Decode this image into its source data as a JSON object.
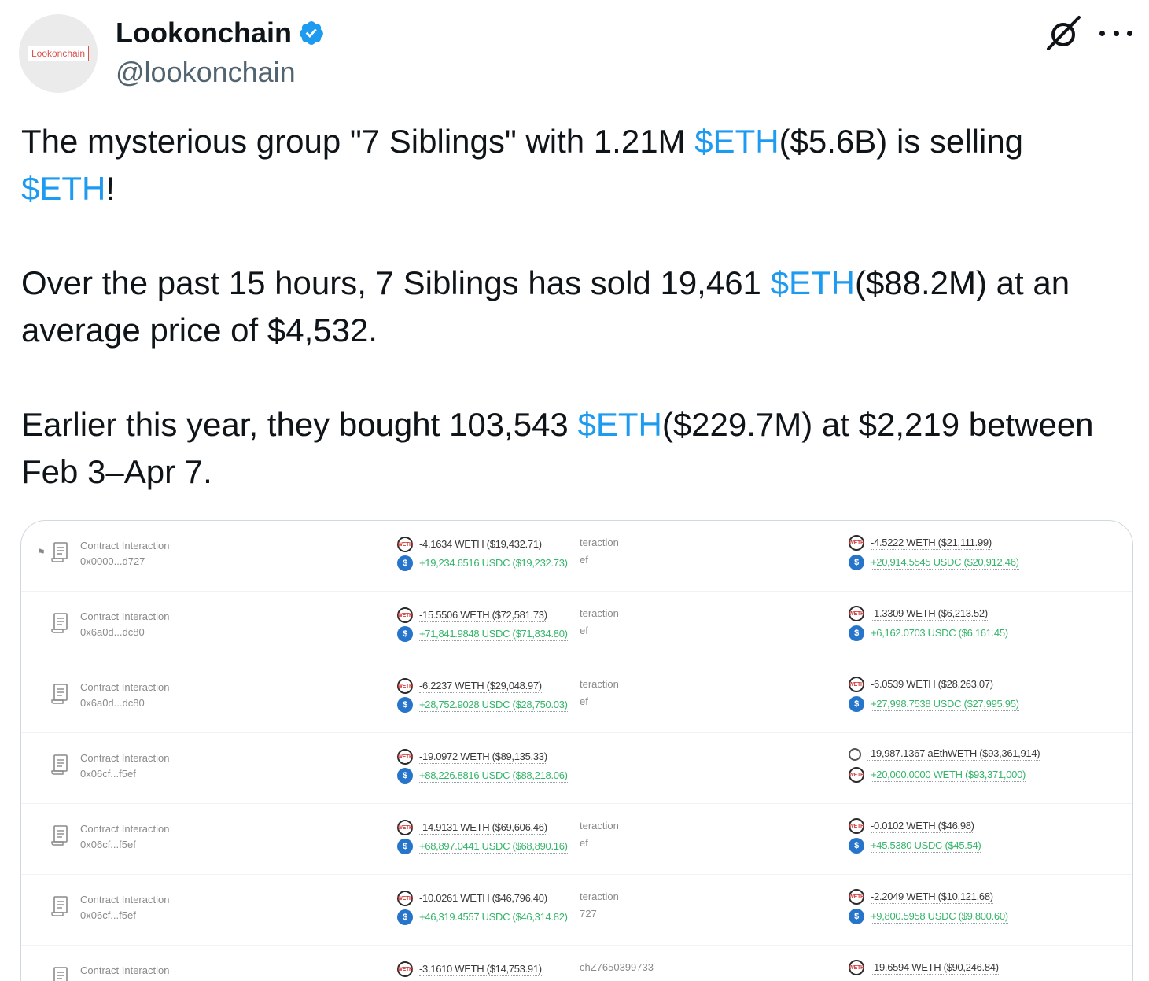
{
  "author": {
    "display_name": "Lookonchain",
    "handle": "@lookonchain",
    "avatar_text": "Lookonchain",
    "verified": true,
    "verified_color": "#1d9bf0"
  },
  "actions": {
    "grok_icon": "grok-icon",
    "more_icon": "more-horizontal-icon"
  },
  "tweet": {
    "p1_a": "The mysterious group \"7 Siblings\" with 1.21M ",
    "p1_tag1": "$ETH",
    "p1_b": "($5.6B) is selling",
    "p1_tag2": "$ETH",
    "p1_c": "!",
    "p2_a": "Over the past 15 hours, 7 Siblings has sold 19,461 ",
    "p2_tag": "$ETH",
    "p2_b": "($88.2M) at an",
    "p2_c": "average price of $4,532.",
    "p3_a": "Earlier this year, they bought 103,543 ",
    "p3_tag": "$ETH",
    "p3_b": "($229.7M) at $2,219 between",
    "p3_c": "Feb 3–Apr 7.",
    "cashtag_color": "#1d9bf0"
  },
  "media": {
    "rows": [
      {
        "title": "Contract Interaction",
        "addr": "0x0000...d727",
        "l_out": "-4.1634 WETH ($19,432.71)",
        "l_in": "+19,234.6516 USDC ($19,232.73)",
        "mid1": "teraction",
        "mid2": "ef",
        "r_out": "-4.5222 WETH ($21,111.99)",
        "r_in": "+20,914.5545 USDC ($20,912.46)"
      },
      {
        "title": "Contract Interaction",
        "addr": "0x6a0d...dc80",
        "l_out": "-15.5506 WETH ($72,581.73)",
        "l_in": "+71,841.9848 USDC ($71,834.80)",
        "mid1": "teraction",
        "mid2": "ef",
        "r_out": "-1.3309 WETH ($6,213.52)",
        "r_in": "+6,162.0703 USDC ($6,161.45)"
      },
      {
        "title": "Contract Interaction",
        "addr": "0x6a0d...dc80",
        "l_out": "-6.2237 WETH ($29,048.97)",
        "l_in": "+28,752.9028 USDC ($28,750.03)",
        "mid1": "teraction",
        "mid2": "ef",
        "r_out": "-6.0539 WETH ($28,263.07)",
        "r_in": "+27,998.7538 USDC ($27,995.95)"
      },
      {
        "title": "Contract Interaction",
        "addr": "0x06cf...f5ef",
        "l_out": "-19.0972 WETH ($89,135.33)",
        "l_in": "+88,226.8816 USDC ($88,218.06)",
        "mid1": "",
        "mid2": "",
        "r_out": "-19,987.1367 aEthWETH ($93,361,914)",
        "r_in": "+20,000.0000 WETH ($93,371,000)"
      },
      {
        "title": "Contract Interaction",
        "addr": "0x06cf...f5ef",
        "l_out": "-14.9131 WETH ($69,606.46)",
        "l_in": "+68,897.0441 USDC ($68,890.16)",
        "mid1": "teraction",
        "mid2": "ef",
        "r_out": "-0.0102 WETH ($46.98)",
        "r_in": "+45.5380 USDC ($45.54)"
      },
      {
        "title": "Contract Interaction",
        "addr": "0x06cf...f5ef",
        "l_out": "-10.0261 WETH ($46,796.40)",
        "l_in": "+46,319.4557 USDC ($46,314.82)",
        "mid1": "teraction",
        "mid2": "727",
        "r_out": "-2.2049 WETH ($10,121.68)",
        "r_in": "+9,800.5958 USDC ($9,800.60)"
      },
      {
        "title": "Contract Interaction",
        "addr": "",
        "l_out": "-3.1610 WETH ($14,753.91)",
        "l_in": "",
        "mid1": "chZ7650399733",
        "mid2": "",
        "r_out": "-19.6594 WETH ($90,246.84)",
        "r_in": ""
      }
    ]
  }
}
